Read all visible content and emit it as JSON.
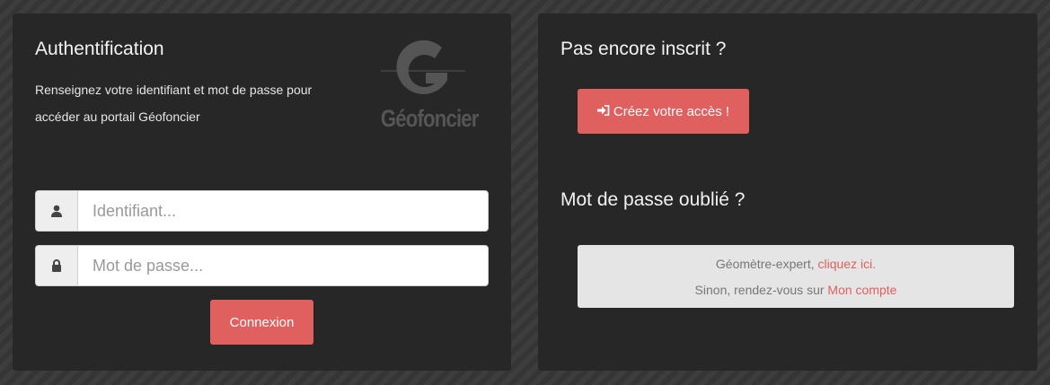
{
  "auth": {
    "title": "Authentification",
    "description": "Renseignez votre identifiant et mot de passe pour accéder au portail Géofoncier",
    "logo_text": "Géofoncier",
    "username_placeholder": "Identifiant...",
    "password_placeholder": "Mot de passe...",
    "login_label": "Connexion"
  },
  "register": {
    "title": "Pas encore inscrit ?",
    "button_label": "Créez votre accès !"
  },
  "forgot": {
    "title": "Mot de passe oublié ?",
    "line1_text": "Géomètre-expert, ",
    "line1_link": "cliquez ici.",
    "line2_text": "Sinon, rendez-vous sur ",
    "line2_link": "Mon compte"
  },
  "colors": {
    "accent": "#e0605f",
    "panel": "#262626",
    "info_box": "#e5e5e5"
  },
  "icons": {
    "username": "user-icon",
    "password": "lock-icon",
    "register": "sign-in-icon"
  }
}
